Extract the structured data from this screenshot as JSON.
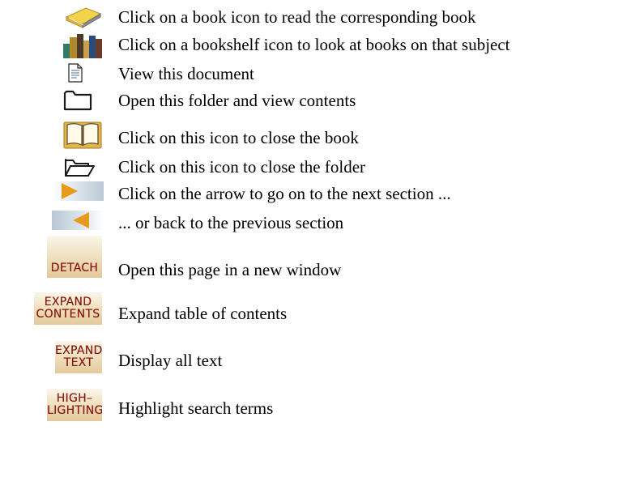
{
  "legend": {
    "rows": [
      {
        "icon": "book-icon",
        "text": "Click on a book icon to read the corresponding book"
      },
      {
        "icon": "bookshelf-icon",
        "text": "Click on a bookshelf icon to look at books on that subject"
      },
      {
        "icon": "document-icon",
        "text": "View this document"
      },
      {
        "icon": "closed-folder-icon",
        "text": "Open this folder and view contents"
      },
      {
        "icon": "open-book-icon",
        "text": "Click on this icon to close the book"
      },
      {
        "icon": "open-folder-icon",
        "text": "Click on this icon to close the folder"
      },
      {
        "icon": "next-arrow-icon",
        "text": "Click on the arrow to go on to the next section ..."
      },
      {
        "icon": "previous-arrow-icon",
        "text": "... or back to the previous section"
      },
      {
        "icon": "detach-button",
        "text": "Open this page in a new window"
      },
      {
        "icon": "expand-contents-button",
        "text": "Expand table of contents"
      },
      {
        "icon": "expand-text-button",
        "text": "Display all text"
      },
      {
        "icon": "highlighting-button",
        "text": "Highlight search terms"
      }
    ]
  },
  "buttons": {
    "detach": {
      "line1": "DETACH"
    },
    "expand_contents": {
      "line1": "EXPAND",
      "line2": "CONTENTS"
    },
    "expand_text": {
      "line1": "EXPAND",
      "line2": "TEXT"
    },
    "highlighting": {
      "line1": "HIGH–",
      "line2": "LIGHTING"
    }
  },
  "colors": {
    "button_label": "#8a1a10",
    "button_fill_top": "#fbf6ea",
    "button_fill_bottom": "#e3c99a",
    "arrow": "#e89a1c",
    "icon_outline": "#1a1a1a"
  }
}
